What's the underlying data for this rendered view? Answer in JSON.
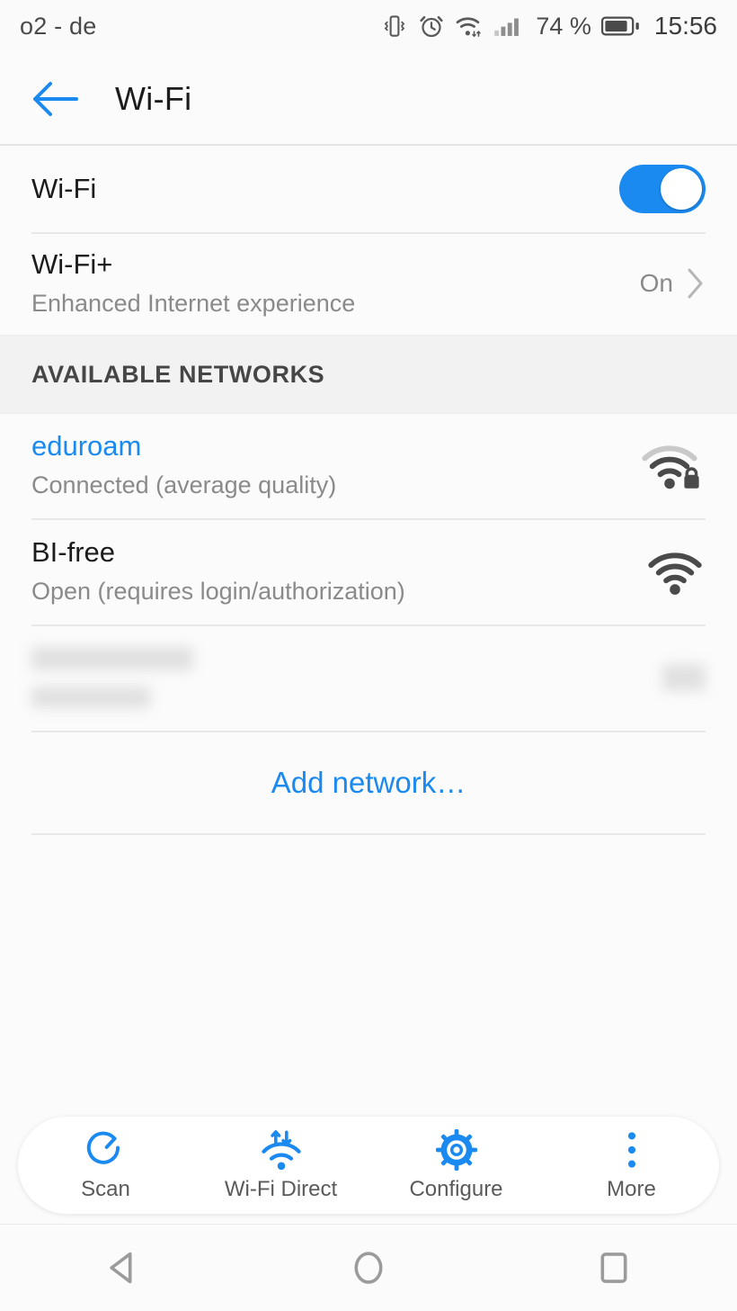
{
  "statusbar": {
    "carrier": "o2 - de",
    "battery_percent": "74 %",
    "clock": "15:56",
    "icons": [
      "vibrate-icon",
      "alarm-icon",
      "wifi-data-icon",
      "signal-bars-icon",
      "battery-icon"
    ]
  },
  "titlebar": {
    "back_icon": "back-arrow-icon",
    "title": "Wi-Fi"
  },
  "settings": {
    "wifi": {
      "label": "Wi-Fi",
      "toggle_on": true
    },
    "wifi_plus": {
      "label": "Wi-Fi+",
      "sublabel": "Enhanced Internet experience",
      "value": "On",
      "chevron_icon": "chevron-right-icon"
    }
  },
  "networks_section": {
    "header": "AVAILABLE NETWORKS",
    "items": [
      {
        "ssid": "eduroam",
        "status": "Connected (average quality)",
        "connected": true,
        "secured": true,
        "signal_bars": 2,
        "icon": "wifi-signal-lock-icon"
      },
      {
        "ssid": "BI-free",
        "status": "Open (requires login/authorization)",
        "connected": false,
        "secured": false,
        "signal_bars": 3,
        "icon": "wifi-signal-icon"
      },
      {
        "ssid": "",
        "status": "",
        "redacted": true,
        "connected": false,
        "secured": false,
        "signal_bars": 0,
        "icon": "redacted-icon"
      }
    ],
    "add_network": "Add network…"
  },
  "toolbar": {
    "items": [
      {
        "label": "Scan",
        "icon": "scan-refresh-icon"
      },
      {
        "label": "Wi-Fi Direct",
        "icon": "wifi-direct-icon"
      },
      {
        "label": "Configure",
        "icon": "gear-icon"
      },
      {
        "label": "More",
        "icon": "more-vertical-icon"
      }
    ]
  },
  "navbar": {
    "back": "nav-back-icon",
    "home": "nav-home-icon",
    "recents": "nav-recents-icon"
  },
  "colors": {
    "accent": "#1b8af0",
    "page_bg": "#fbfbfb",
    "section_bg": "#f2f2f2",
    "primary_text": "#1c1c1c",
    "secondary_text": "#8a8a8a"
  }
}
